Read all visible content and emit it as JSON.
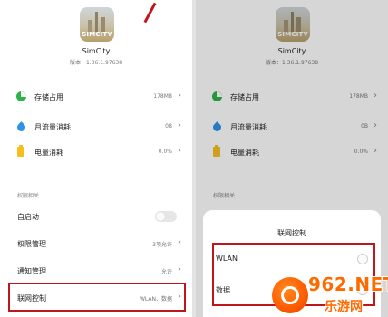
{
  "app": {
    "name": "SimCity",
    "icon_text": "SIMCITY",
    "version": "版本：1.36.1.97638"
  },
  "stats": [
    {
      "label": "存储占用",
      "value": "178MB",
      "icon": "storage-icon"
    },
    {
      "label": "月流量消耗",
      "value": "0B",
      "icon": "data-drop-icon"
    },
    {
      "label": "电量消耗",
      "value": "0.0%",
      "icon": "battery-icon"
    }
  ],
  "permissions": {
    "section_title": "权限相关",
    "items": [
      {
        "label": "自启动",
        "value": "",
        "control": "toggle"
      },
      {
        "label": "权限管理",
        "value": "3项允许"
      },
      {
        "label": "通知管理",
        "value": "允许"
      },
      {
        "label": "联网控制",
        "value": "WLAN、数据"
      }
    ]
  },
  "dialog": {
    "title": "联网控制",
    "options": [
      "WLAN",
      "数据"
    ]
  },
  "watermark": {
    "main": "962.NET",
    "sub": "乐游网"
  },
  "colors": {
    "highlight": "#c0161b",
    "storage": "#2bb34a",
    "data": "#2e93e8",
    "battery": "#f7bf1e",
    "watermark": "#ff6a00"
  }
}
